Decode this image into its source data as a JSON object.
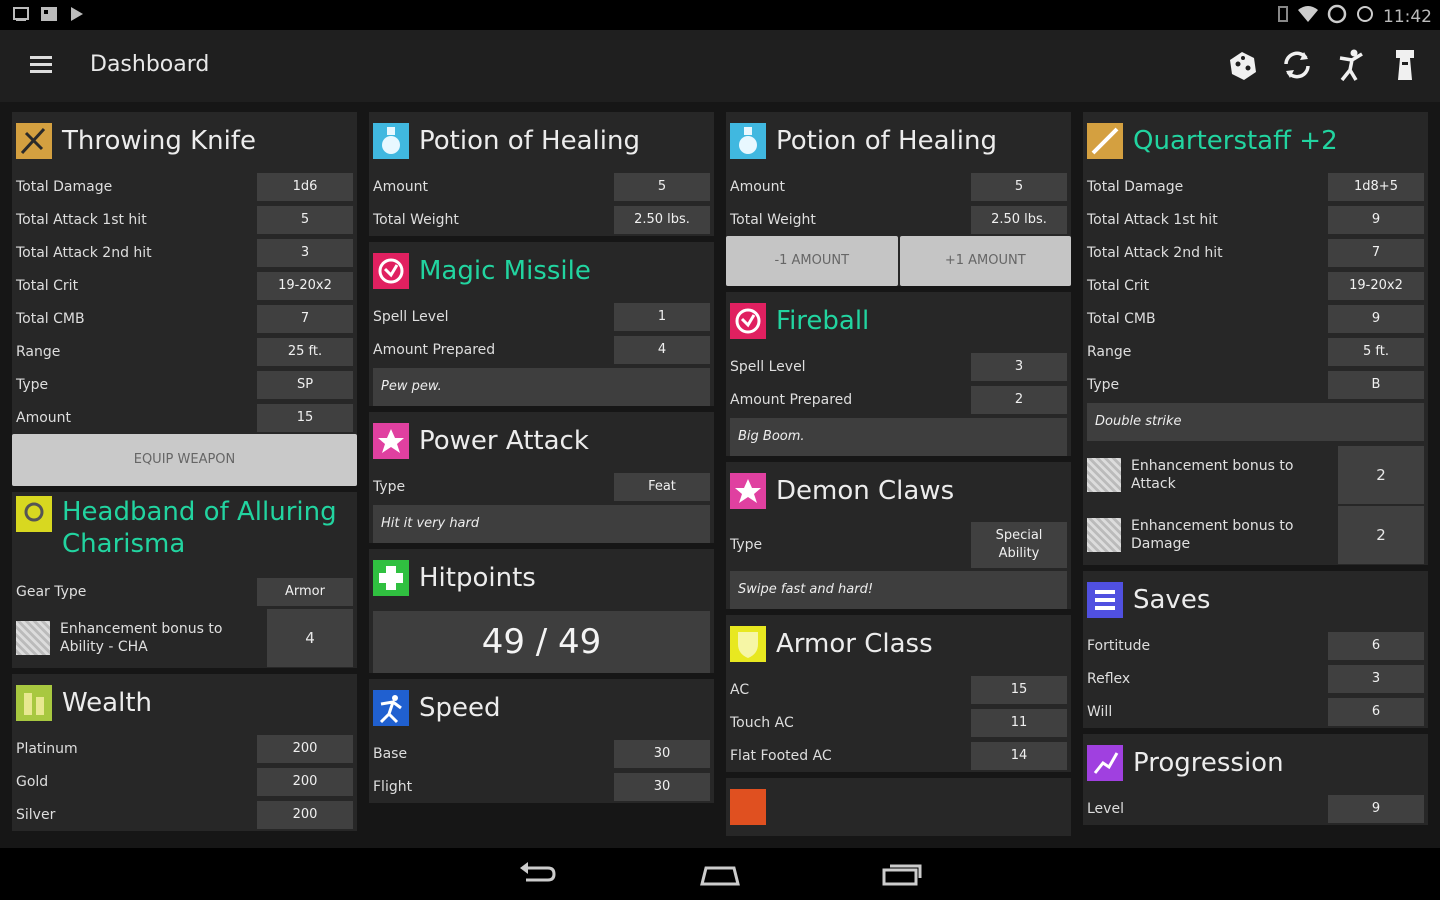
{
  "app": {
    "title": "Dashboard",
    "clock": "11:42"
  },
  "icons": {
    "menu": "hamburger-icon",
    "dice": "dice-icon",
    "sync": "sync-icon",
    "combat": "combat-icon",
    "rest": "rest-icon",
    "back": "back-icon",
    "home": "home-icon",
    "recents": "recents-icon"
  },
  "colors": {
    "accent_green": "#22d4a0",
    "card_bg": "#272727",
    "value_bg": "#404040"
  },
  "col1": {
    "throwing_knife": {
      "title": "Throwing Knife",
      "rows": [
        {
          "label": "Total Damage",
          "value": "1d6"
        },
        {
          "label": "Total Attack 1st hit",
          "value": "5"
        },
        {
          "label": "Total Attack 2nd hit",
          "value": "3"
        },
        {
          "label": "Total Crit",
          "value": "19-20x2"
        },
        {
          "label": "Total CMB",
          "value": "7"
        },
        {
          "label": "Range",
          "value": "25 ft."
        },
        {
          "label": "Type",
          "value": "SP"
        },
        {
          "label": "Amount",
          "value": "15"
        }
      ],
      "button": "EQUIP WEAPON"
    },
    "headband": {
      "title_line1": "Headband of Alluring",
      "title_line2": "Charisma",
      "gear_label": "Gear Type",
      "gear_value": "Armor",
      "enh_line1": "Enhancement bonus to",
      "enh_line2": "Ability - CHA",
      "enh_value": "4"
    },
    "wealth": {
      "title": "Wealth",
      "rows": [
        {
          "label": "Platinum",
          "value": "200"
        },
        {
          "label": "Gold",
          "value": "200"
        },
        {
          "label": "Silver",
          "value": "200"
        }
      ]
    }
  },
  "col2": {
    "potion": {
      "title": "Potion of Healing",
      "rows": [
        {
          "label": "Amount",
          "value": "5"
        },
        {
          "label": "Total Weight",
          "value": "2.50 lbs."
        }
      ]
    },
    "magic_missile": {
      "title": "Magic Missile",
      "rows": [
        {
          "label": "Spell Level",
          "value": "1"
        },
        {
          "label": "Amount Prepared",
          "value": "4"
        }
      ],
      "note": "Pew pew."
    },
    "power_attack": {
      "title": "Power Attack",
      "rows": [
        {
          "label": "Type",
          "value": "Feat"
        }
      ],
      "note": "Hit it very hard"
    },
    "hitpoints": {
      "title": "Hitpoints",
      "value": "49 / 49"
    },
    "speed": {
      "title": "Speed",
      "rows": [
        {
          "label": "Base",
          "value": "30"
        },
        {
          "label": "Flight",
          "value": "30"
        }
      ]
    }
  },
  "col3": {
    "potion": {
      "title": "Potion of Healing",
      "rows": [
        {
          "label": "Amount",
          "value": "5"
        },
        {
          "label": "Total Weight",
          "value": "2.50 lbs."
        }
      ],
      "minus": "-1 AMOUNT",
      "plus": "+1 AMOUNT"
    },
    "fireball": {
      "title": "Fireball",
      "rows": [
        {
          "label": "Spell Level",
          "value": "3"
        },
        {
          "label": "Amount Prepared",
          "value": "2"
        }
      ],
      "note": "Big Boom."
    },
    "demon_claws": {
      "title": "Demon Claws",
      "type_label": "Type",
      "type_value_1": "Special",
      "type_value_2": "Ability",
      "note": "Swipe fast and hard!"
    },
    "armor_class": {
      "title": "Armor Class",
      "rows": [
        {
          "label": "AC",
          "value": "15"
        },
        {
          "label": "Touch AC",
          "value": "11"
        },
        {
          "label": "Flat Footed AC",
          "value": "14"
        }
      ]
    }
  },
  "col4": {
    "quarterstaff": {
      "title": "Quarterstaff +2",
      "rows": [
        {
          "label": "Total Damage",
          "value": "1d8+5"
        },
        {
          "label": "Total Attack 1st hit",
          "value": "9"
        },
        {
          "label": "Total Attack 2nd hit",
          "value": "7"
        },
        {
          "label": "Total Crit",
          "value": "19-20x2"
        },
        {
          "label": "Total CMB",
          "value": "9"
        },
        {
          "label": "Range",
          "value": "5 ft."
        },
        {
          "label": "Type",
          "value": "B"
        }
      ],
      "note": "Double strike",
      "enh": [
        {
          "line1": "Enhancement bonus to",
          "line2": "Attack",
          "value": "2"
        },
        {
          "line1": "Enhancement bonus to",
          "line2": "Damage",
          "value": "2"
        }
      ]
    },
    "saves": {
      "title": "Saves",
      "rows": [
        {
          "label": "Fortitude",
          "value": "6"
        },
        {
          "label": "Reflex",
          "value": "3"
        },
        {
          "label": "Will",
          "value": "6"
        }
      ]
    },
    "progression": {
      "title": "Progression",
      "rows": [
        {
          "label": "Level",
          "value": "9"
        }
      ]
    }
  }
}
